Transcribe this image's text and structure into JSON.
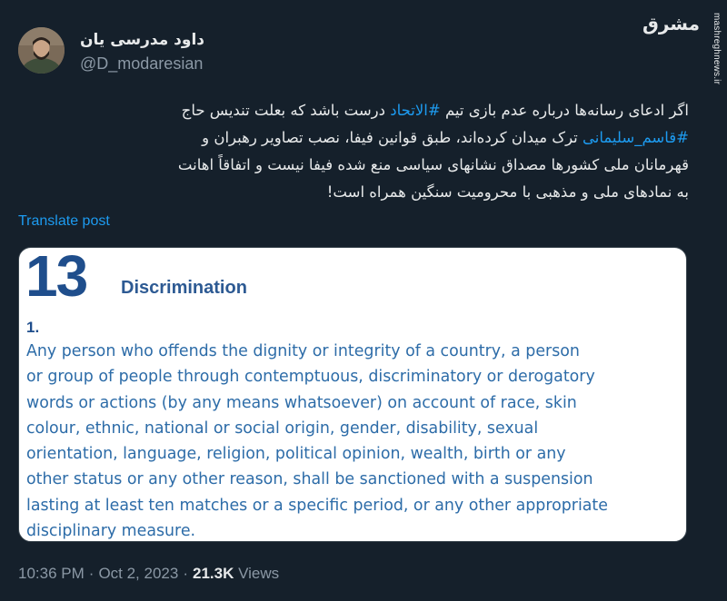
{
  "author": {
    "display_name": "داود مدرسی یان",
    "handle": "@D_modaresian"
  },
  "watermark": {
    "logo_text": "مشرق",
    "url": "mashreghnews.ir"
  },
  "tweet": {
    "line1_pre": "اگر ادعای رسانه‌ها درباره عدم بازی تیم ",
    "hashtag1": "#الاتحاد",
    "line1_post": " درست باشد که بعلت تندیس حاج",
    "hashtag2": "#قاسم_سلیمانی",
    "line2_post": " ترک میدان کرده‌اند، طبق قوانین فیفا، نصب تصاویر رهبران و",
    "line3": "قهرمانان ملی کشورها مصداق نشانهای سیاسی منع شده فیفا نیست و اتفاقاً اهانت",
    "line4": "به نمادهای ملی و مذهبی با محرومیت سنگین همراه است!",
    "translate_label": "Translate post"
  },
  "media": {
    "article_number": "13",
    "article_title": "Discrimination",
    "paragraph_number": "1.",
    "paragraph_lines": [
      "Any person who offends the dignity or integrity of a country, a person",
      "or group of people through contemptuous, discriminatory or derogatory",
      "words or actions (by any means whatsoever) on account of race, skin",
      "colour, ethnic, national or social origin, gender, disability, sexual",
      "orientation, language, religion, political opinion, wealth, birth or any",
      "other status or any other reason, shall be sanctioned with a suspension",
      "lasting at least ten matches or a specific period, or any other appropriate",
      "disciplinary measure."
    ]
  },
  "meta": {
    "time": "10:36 PM",
    "separator": "·",
    "date": "Oct 2, 2023",
    "views_count": "21.3K",
    "views_label": "Views"
  },
  "colors": {
    "background": "#15202b",
    "text_primary": "#e7e9ea",
    "text_secondary": "#8b98a5",
    "link": "#1d9bf0",
    "doc_number": "#1f4e8c",
    "doc_text": "#2d6ca8"
  }
}
